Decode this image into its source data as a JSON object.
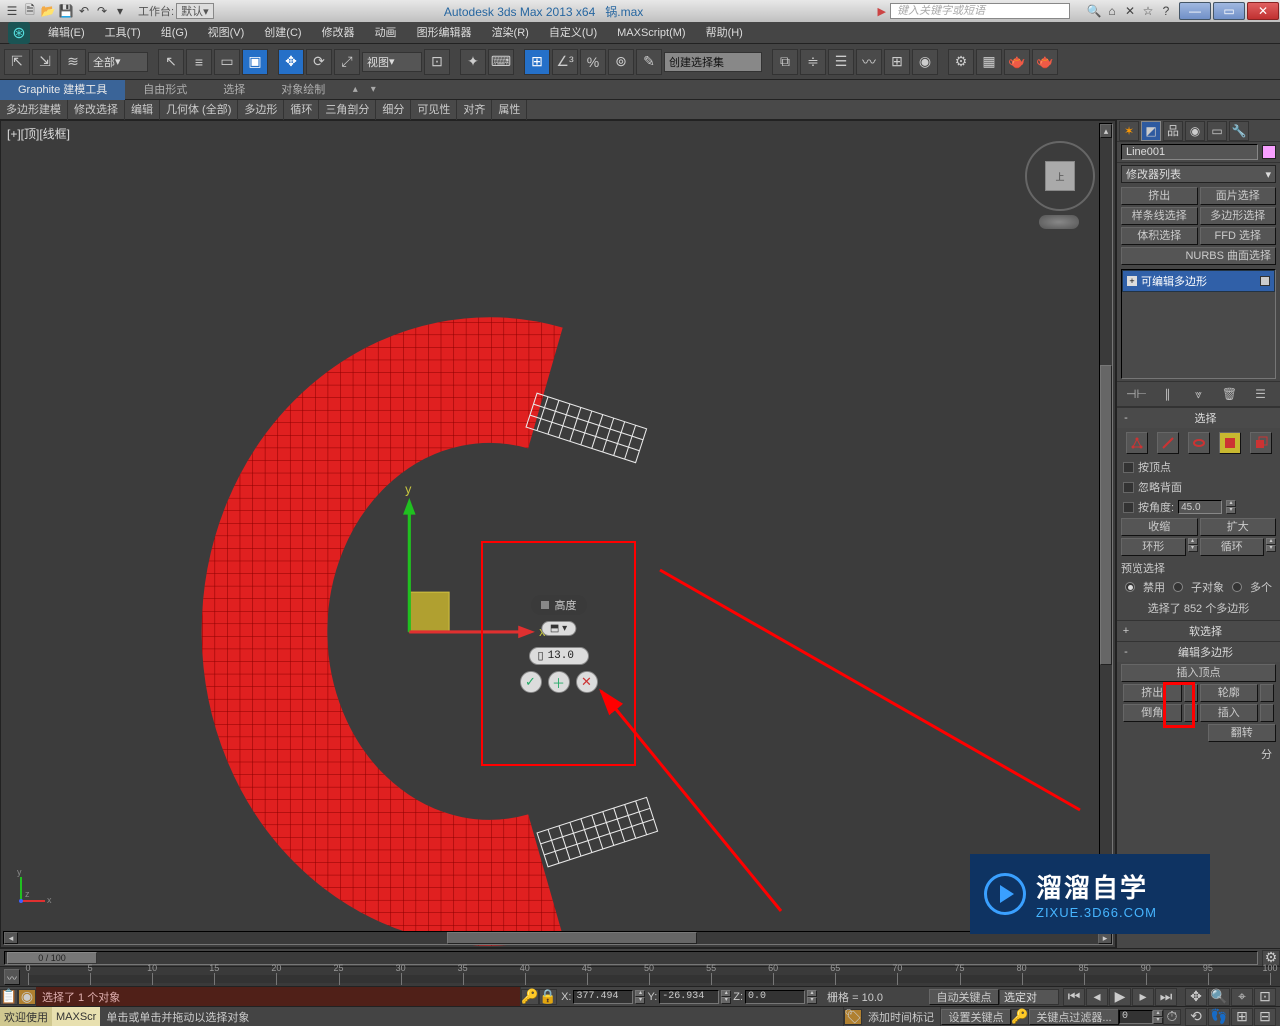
{
  "title": {
    "workspace_label": "工作台:",
    "workspace_value": "默认",
    "app": "Autodesk 3ds Max  2013 x64",
    "file": "锅.max",
    "search_placeholder": "键入关键字或短语"
  },
  "menu": [
    "编辑(E)",
    "工具(T)",
    "组(G)",
    "视图(V)",
    "创建(C)",
    "修改器",
    "动画",
    "图形编辑器",
    "渲染(R)",
    "自定义(U)",
    "MAXScript(M)",
    "帮助(H)"
  ],
  "toolbar": {
    "filter_all": "全部",
    "view_dropdown": "视图",
    "named_set_placeholder": "创建选择集"
  },
  "ribbon_tabs": [
    "Graphite 建模工具",
    "自由形式",
    "选择",
    "对象绘制"
  ],
  "sub_tabs": [
    "多边形建模",
    "修改选择",
    "编辑",
    "几何体 (全部)",
    "多边形",
    "循环",
    "三角剖分",
    "细分",
    "可见性",
    "对齐",
    "属性"
  ],
  "viewport": {
    "label": "[+][顶][线框]",
    "axis_x": "x",
    "axis_y": "y",
    "axis_z": "z",
    "viewcube_face": "上"
  },
  "caddy": {
    "title": "高度",
    "value": "13.0",
    "mode_icon": "⬒ ▾"
  },
  "cmd": {
    "object_name": "Line001",
    "modifier_dropdown": "修改器列表",
    "quick_buttons": [
      "挤出",
      "面片选择",
      "样条线选择",
      "多边形选择",
      "体积选择",
      "FFD 选择"
    ],
    "nurbs_btn": "NURBS 曲面选择",
    "stack_item": "可编辑多边形",
    "rollout_select": {
      "title": "选择",
      "by_vertex": "按顶点",
      "ignore_backface": "忽略背面",
      "by_angle": "按角度:",
      "angle_value": "45.0",
      "shrink": "收缩",
      "grow": "扩大",
      "ring": "环形",
      "loop": "循环",
      "preview_label": "预览选择",
      "preview_off": "禁用",
      "preview_sub": "子对象",
      "preview_multi": "多个",
      "selected_info": "选择了 852 个多边形"
    },
    "rollout_soft": "软选择",
    "rollout_editpoly": {
      "title": "编辑多边形",
      "insert_vertex": "插入顶点",
      "extrude": "挤出",
      "outline": "轮廓",
      "bevel": "倒角",
      "inset": "插入",
      "flip": "翻转"
    },
    "rollout_more_ellipsis": "分"
  },
  "time": {
    "handle": "0 / 100",
    "ruler_labels": [
      "0",
      "5",
      "10",
      "15",
      "20",
      "25",
      "30",
      "35",
      "40",
      "45",
      "50",
      "55",
      "60",
      "65",
      "70",
      "75",
      "80",
      "85",
      "90",
      "95",
      "100"
    ]
  },
  "status": {
    "sel_info": "选择了 1 个对象",
    "x_label": "X:",
    "x_val": "377.494",
    "y_label": "Y:",
    "y_val": "-26.934",
    "z_label": "Z:",
    "z_val": "0.0",
    "grid": "栅格 = 10.0",
    "auto_key": "自动关键点",
    "sel_filter": "选定对",
    "prompt": "单击或单击并拖动以选择对象",
    "add_time_tag": "添加时间标记",
    "set_key": "设置关键点",
    "key_filters": "关键点过滤器...",
    "welcome": "欢迎使用",
    "maxscript": "MAXScr",
    "frame": "0",
    "lock": "🔒",
    "key_icon": "🔑"
  },
  "watermark": {
    "cn": "溜溜自学",
    "url": "ZIXUE.3D66.COM"
  }
}
